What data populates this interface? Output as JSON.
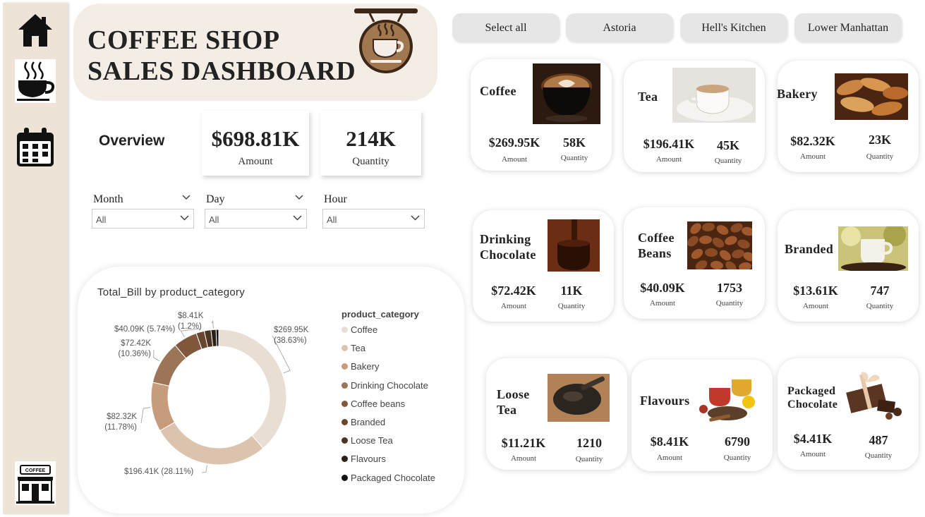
{
  "sidebar": {
    "icons": [
      "home-icon",
      "coffee-cup-icon",
      "calendar-icon",
      "coffee-shop-icon"
    ],
    "shop_sign": "COFFEE"
  },
  "header": {
    "title_line1": "COFFEE SHOP",
    "title_line2": "SALES DASHBOARD"
  },
  "overview": {
    "label": "Overview",
    "amount_value": "$698.81K",
    "amount_label": "Amount",
    "quantity_value": "214K",
    "quantity_label": "Quantity"
  },
  "filters": {
    "month": {
      "label": "Month",
      "value": "All"
    },
    "day": {
      "label": "Day",
      "value": "All"
    },
    "hour": {
      "label": "Hour",
      "value": "All"
    }
  },
  "locations": [
    "Select all",
    "Astoria",
    "Hell's Kitchen",
    "Lower Manhattan"
  ],
  "chart_data": {
    "type": "pie",
    "title": "Total_Bill by product_category",
    "legend_title": "product_category",
    "legend_position": "right",
    "categories": [
      "Coffee",
      "Tea",
      "Bakery",
      "Drinking Chocolate",
      "Coffee beans",
      "Branded",
      "Loose Tea",
      "Flavours",
      "Packaged Chocolate"
    ],
    "values": [
      269.95,
      196.41,
      82.32,
      72.42,
      40.09,
      13.61,
      11.21,
      8.41,
      4.41
    ],
    "colors": [
      "#e9ded4",
      "#dcc3ad",
      "#c69c7c",
      "#9c7457",
      "#81583d",
      "#684630",
      "#4d3423",
      "#2c1f16",
      "#111111"
    ],
    "labels": [
      "$269.95K (38.63%)",
      "$196.41K (28.11%)",
      "$82.32K (11.78%)",
      "$72.42K (10.36%)",
      "$40.09K (5.74%)",
      "$8.41K (1.2%)"
    ],
    "label_parts": {
      "coffee": [
        "$269.95K",
        "(38.63%)"
      ],
      "tea": "$196.41K (28.11%)",
      "bakery": [
        "$82.32K",
        "(11.78%)"
      ],
      "drinking_chocolate": [
        "$72.42K",
        "(10.36%)"
      ],
      "coffee_beans": "$40.09K (5.74%)",
      "flavours": [
        "$8.41K",
        "(1.2%)"
      ]
    }
  },
  "cards": [
    {
      "name": "Coffee",
      "amount": "$269.95K",
      "quantity": "58K",
      "amount_label": "Amount",
      "quantity_label": "Quantity"
    },
    {
      "name": "Tea",
      "amount": "$196.41K",
      "quantity": "45K",
      "amount_label": "Amount",
      "quantity_label": "Quantity"
    },
    {
      "name": "Bakery",
      "amount": "$82.32K",
      "quantity": "23K",
      "amount_label": "Amount",
      "quantity_label": "Quantity"
    },
    {
      "name_line1": "Drinking",
      "name_line2": "Chocolate",
      "amount": "$72.42K",
      "quantity": "11K",
      "amount_label": "Amount",
      "quantity_label": "Quantity"
    },
    {
      "name_line1": "Coffee",
      "name_line2": "Beans",
      "amount": "$40.09K",
      "quantity": "1753",
      "amount_label": "Amount",
      "quantity_label": "Quantity"
    },
    {
      "name": "Branded",
      "amount": "$13.61K",
      "quantity": "747",
      "amount_label": "Amount",
      "quantity_label": "Quantity"
    },
    {
      "name_line1": "Loose",
      "name_line2": "Tea",
      "amount": "$11.21K",
      "quantity": "1210",
      "amount_label": "Amount",
      "quantity_label": "Quantity"
    },
    {
      "name": "Flavours",
      "amount": "$8.41K",
      "quantity": "6790",
      "amount_label": "Amount",
      "quantity_label": "Quantity"
    },
    {
      "name_line1": "Packaged",
      "name_line2": "Chocolate",
      "amount": "$4.41K",
      "quantity": "487",
      "amount_label": "Amount",
      "quantity_label": "Quantity"
    }
  ]
}
